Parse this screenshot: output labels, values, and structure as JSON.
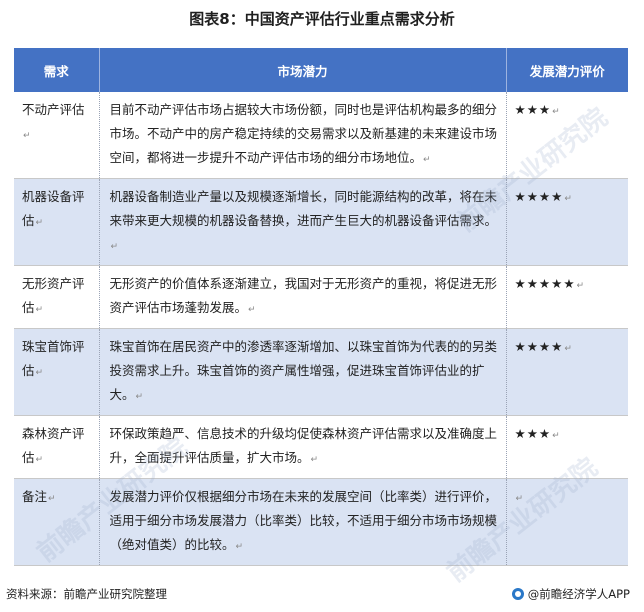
{
  "title": "图表8：中国资产评估行业重点需求分析",
  "headers": [
    "需求",
    "市场潜力",
    "发展潜力评价"
  ],
  "rows": [
    {
      "need": "不动产评估",
      "potential": "目前不动产评估市场占据较大市场份额，同时也是评估机构最多的细分市场。不动产中的房产稳定持续的交易需求以及新基建的未来建设市场空间，都将进一步提升不动产评估市场的细分市场地位。",
      "rating": "★★★"
    },
    {
      "need": "机器设备评估",
      "potential": "机器设备制造业产量以及规模逐渐增长，同时能源结构的改革，将在未来带来更大规模的机器设备替换，进而产生巨大的机器设备评估需求。",
      "rating": "★★★★"
    },
    {
      "need": "无形资产评估",
      "potential": "无形资产的价值体系逐渐建立，我国对于无形资产的重视，将促进无形资产评估市场蓬勃发展。",
      "rating": "★★★★★"
    },
    {
      "need": "珠宝首饰评估",
      "potential": "珠宝首饰在居民资产中的渗透率逐渐增加、以珠宝首饰为代表的的另类投资需求上升。珠宝首饰的资产属性增强，促进珠宝首饰评估业的扩大。",
      "rating": "★★★★"
    },
    {
      "need": "森林资产评估",
      "potential": "环保政策趋严、信息技术的升级均促使森林资产评估需求以及准确度上升，全面提升评估质量，扩大市场。",
      "rating": "★★★"
    },
    {
      "need": "备注",
      "potential": "发展潜力评价仅根据细分市场在未来的发展空间（比率类）进行评价，适用于细分市场发展潜力（比率类）比较，不适用于细分市场市场规模（绝对值类）的比较。",
      "rating": ""
    }
  ],
  "para_mark": "↵",
  "source": "资料来源：前瞻产业研究院整理",
  "brand": "@前瞻经济学人APP",
  "watermark": "前瞻产业研究院"
}
